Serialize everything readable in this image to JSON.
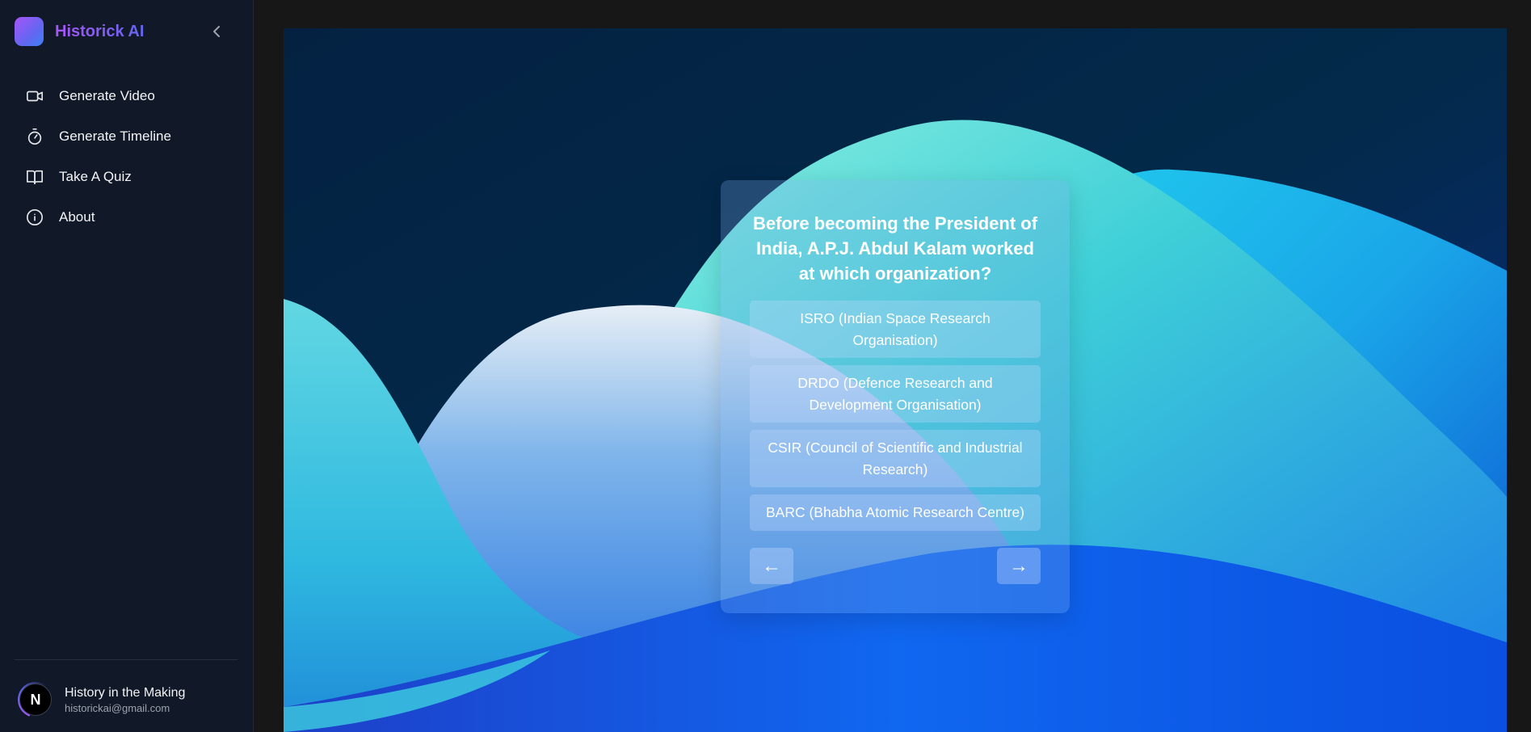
{
  "sidebar": {
    "brand": "Historick AI",
    "nav": [
      {
        "label": "Generate Video",
        "icon": "video-camera-icon"
      },
      {
        "label": "Generate Timeline",
        "icon": "stopwatch-icon"
      },
      {
        "label": "Take A Quiz",
        "icon": "open-book-icon"
      },
      {
        "label": "About",
        "icon": "info-icon"
      }
    ],
    "user": {
      "initial": "N",
      "name": "History in the Making",
      "email": "historickai@gmail.com"
    }
  },
  "quiz": {
    "question": "Before becoming the President of India, A.P.J. Abdul Kalam worked at which organization?",
    "options": [
      "ISRO (Indian Space Research Organisation)",
      "DRDO (Defence Research and Development Organisation)",
      "CSIR (Council of Scientific and Industrial Research)",
      "BARC (Bhabha Atomic Research Centre)"
    ],
    "prev_label": "←",
    "next_label": "→"
  },
  "colors": {
    "brand_purple": "#a855f7",
    "brand_indigo": "#6366f1",
    "sidebar_bg": "#111827",
    "page_bg": "#171717"
  }
}
